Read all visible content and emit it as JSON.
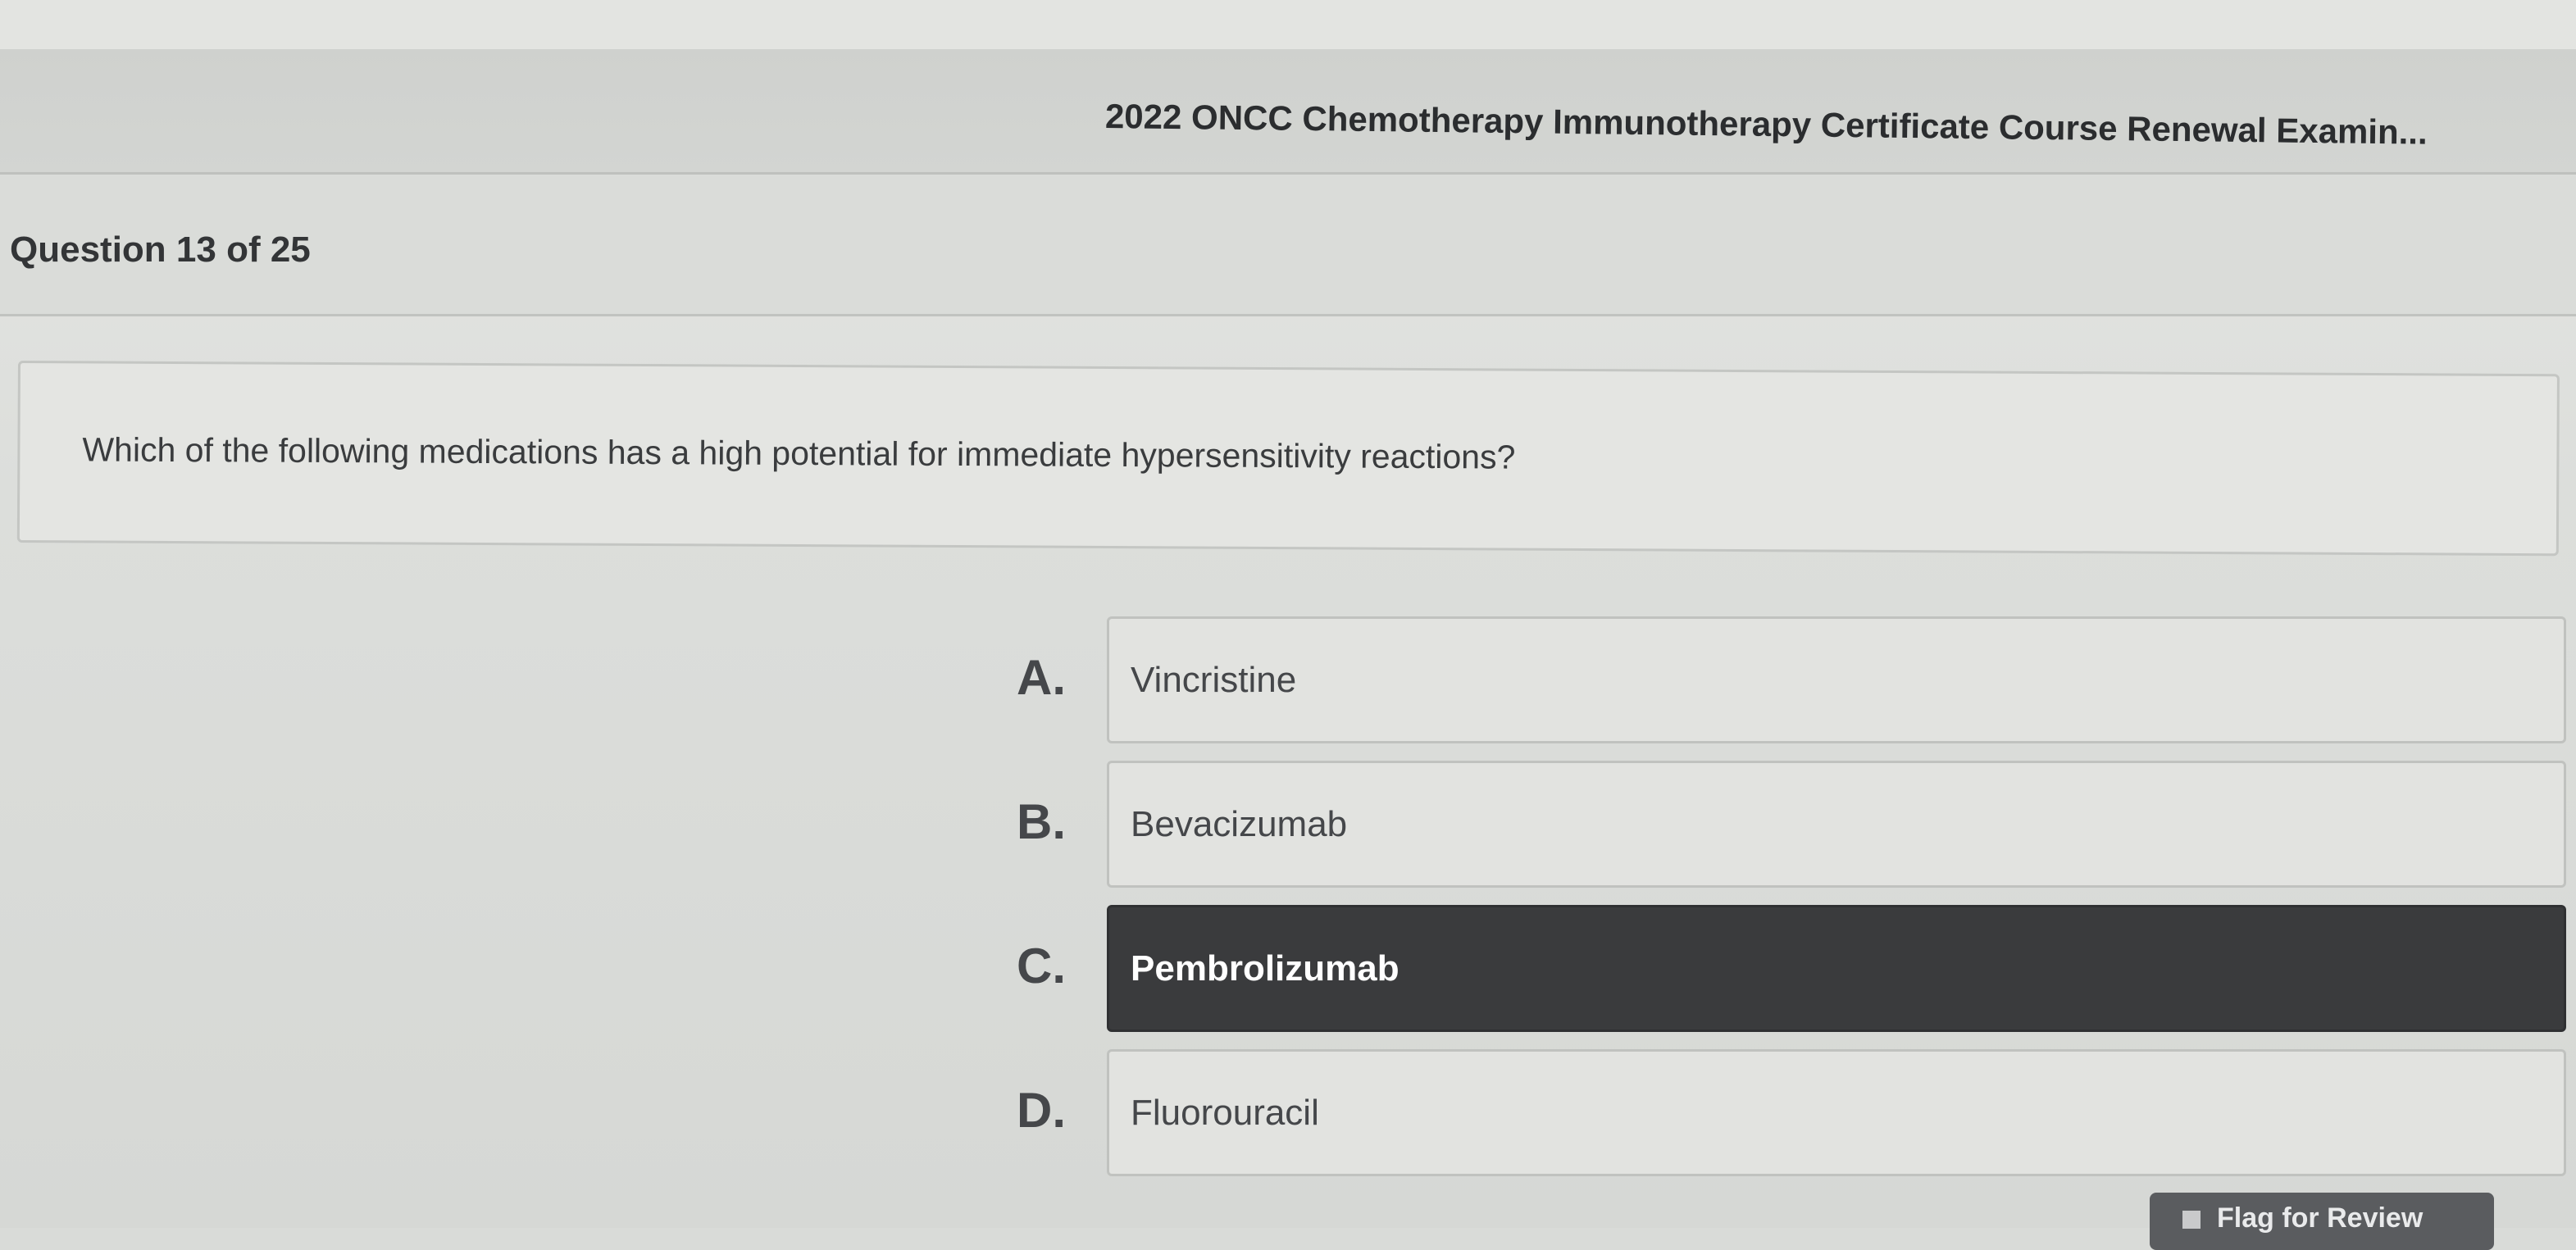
{
  "header": {
    "exam_title": "2022 ONCC Chemotherapy Immunotherapy Certificate Course Renewal Examin..."
  },
  "question": {
    "counter": "Question 13 of 25",
    "text": "Which of the following medications has a high potential for immediate hypersensitivity reactions?"
  },
  "answers": [
    {
      "letter": "A.",
      "text": "Vincristine",
      "selected": false
    },
    {
      "letter": "B.",
      "text": "Bevacizumab",
      "selected": false
    },
    {
      "letter": "C.",
      "text": "Pembrolizumab",
      "selected": true
    },
    {
      "letter": "D.",
      "text": "Fluorouracil",
      "selected": false
    }
  ],
  "footer": {
    "review_button_label": "Flag for Review"
  },
  "colors": {
    "selected_answer_bg": "#3a3b3d",
    "selected_answer_text": "#ffffff",
    "background": "#dcdedb"
  }
}
